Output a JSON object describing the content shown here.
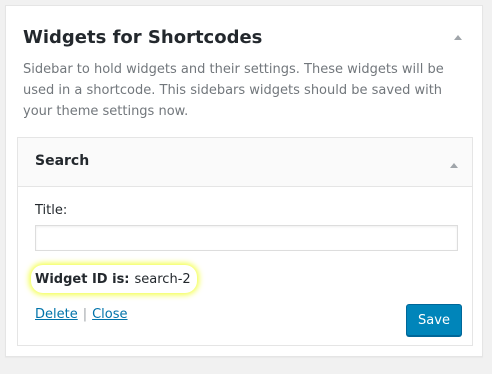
{
  "sidebar": {
    "title": "Widgets for Shortcodes",
    "description": "Sidebar to hold widgets and their settings. These widgets will be used in a shortcode. This sidebars widgets should be saved with your theme settings now."
  },
  "widget": {
    "title": "Search",
    "title_field_label": "Title:",
    "title_field_value": "",
    "widget_id_label": "Widget ID is:",
    "widget_id_value": "search-2",
    "delete_label": "Delete",
    "separator": "|",
    "close_label": "Close",
    "save_label": "Save"
  },
  "colors": {
    "accent": "#0085ba",
    "link": "#0073aa",
    "highlight": "#f3ff4a"
  },
  "icons": {
    "collapse": "arrow-up-icon"
  }
}
